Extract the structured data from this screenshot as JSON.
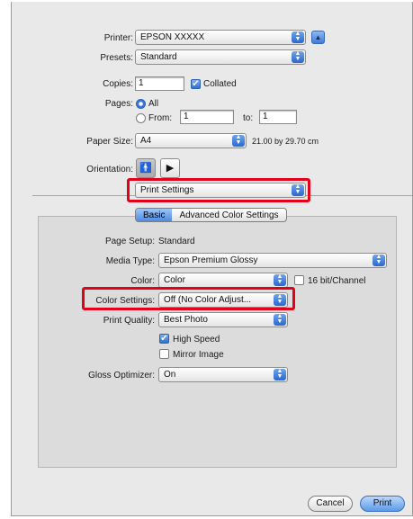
{
  "printer": {
    "label": "Printer:",
    "value": "EPSON XXXXX"
  },
  "presets": {
    "label": "Presets:",
    "value": "Standard"
  },
  "copies": {
    "label": "Copies:",
    "value": "1",
    "collated_label": "Collated",
    "collated": true
  },
  "pages": {
    "label": "Pages:",
    "all_label": "All",
    "from_label": "From:",
    "from_value": "1",
    "to_label": "to:",
    "to_value": "1",
    "selected": "All"
  },
  "paper_size": {
    "label": "Paper Size:",
    "value": "A4",
    "dimensions": "21.00 by 29.70 cm"
  },
  "orientation": {
    "label": "Orientation:",
    "portrait_icon": "portrait-orientation-icon",
    "landscape_icon": "landscape-orientation-icon",
    "selected": "portrait"
  },
  "section_popup": {
    "value": "Print Settings"
  },
  "tabs": [
    {
      "label": "Basic",
      "selected": true
    },
    {
      "label": "Advanced Color Settings",
      "selected": false
    }
  ],
  "page_setup": {
    "label": "Page Setup:",
    "value": "Standard"
  },
  "media_type": {
    "label": "Media Type:",
    "value": "Epson Premium Glossy"
  },
  "color": {
    "label": "Color:",
    "value": "Color",
    "bit_label": "16 bit/Channel",
    "bit_checked": false
  },
  "color_settings": {
    "label": "Color Settings:",
    "value": "Off (No Color Adjust..."
  },
  "print_quality": {
    "label": "Print Quality:",
    "value": "Best Photo"
  },
  "high_speed": {
    "label": "High Speed",
    "checked": true
  },
  "mirror_image": {
    "label": "Mirror Image",
    "checked": false
  },
  "gloss_optimizer": {
    "label": "Gloss Optimizer:",
    "value": "On"
  },
  "buttons": {
    "cancel": "Cancel",
    "print": "Print"
  },
  "colors": {
    "highlight": "#e3001b",
    "accent": "#3a78dc"
  }
}
